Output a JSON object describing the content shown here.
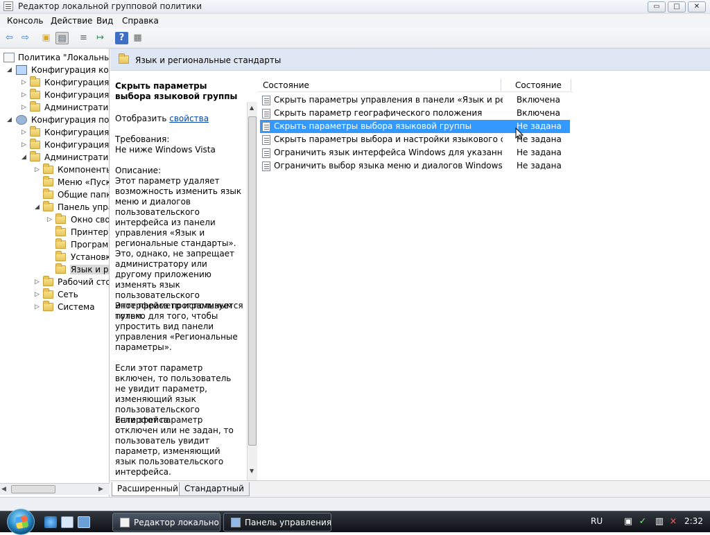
{
  "window": {
    "title": "Редактор локальной групповой политики",
    "controls": {
      "minimize": "▭",
      "maximize": "□",
      "close": "✕"
    }
  },
  "menu": {
    "items": [
      "Консоль",
      "Действие",
      "Вид",
      "Справка"
    ]
  },
  "toolbar": {
    "icons": [
      {
        "name": "back-arrow-icon",
        "glyph": "⇦",
        "color": "#2b78d0"
      },
      {
        "name": "forward-arrow-icon",
        "glyph": "⇨",
        "color": "#2b78d0"
      },
      {
        "name": "up-folder-icon",
        "glyph": "▣",
        "color": "#d9a92d"
      },
      {
        "name": "show-hide-tree-icon",
        "glyph": "▤",
        "color": "#5f6670"
      },
      {
        "name": "export-list-icon",
        "glyph": "≡",
        "color": "#666"
      },
      {
        "name": "export-arrow-icon",
        "glyph": "↦",
        "color": "#2e8b57"
      },
      {
        "name": "help-icon",
        "glyph": "?",
        "color": "#ffffff"
      },
      {
        "name": "extended-view-icon",
        "glyph": "▦",
        "color": "#666"
      }
    ]
  },
  "tree": {
    "items": [
      {
        "label": "Политика \"Локальный",
        "depth": 0,
        "expanded": "",
        "icon": "computer"
      },
      {
        "label": "Конфигурация комп",
        "depth": 1,
        "expanded": "◢",
        "icon": "computer"
      },
      {
        "label": "Конфигурация п",
        "depth": 2,
        "expanded": "▷",
        "icon": "folder"
      },
      {
        "label": "Конфигурация W",
        "depth": 2,
        "expanded": "▷",
        "icon": "folder"
      },
      {
        "label": "Административ",
        "depth": 2,
        "expanded": "▷",
        "icon": "folder"
      },
      {
        "label": "Конфигурация поль",
        "depth": 1,
        "expanded": "◢",
        "icon": "user"
      },
      {
        "label": "Конфигурация п",
        "depth": 2,
        "expanded": "▷",
        "icon": "folder"
      },
      {
        "label": "Конфигурация W",
        "depth": 2,
        "expanded": "▷",
        "icon": "folder"
      },
      {
        "label": "Административ",
        "depth": 2,
        "expanded": "◢",
        "icon": "folder"
      },
      {
        "label": "Компоненты",
        "depth": 3,
        "expanded": "▷",
        "icon": "folder"
      },
      {
        "label": "Меню «Пуск",
        "depth": 3,
        "expanded": "",
        "icon": "folder"
      },
      {
        "label": "Общие папк",
        "depth": 3,
        "expanded": "",
        "icon": "folder"
      },
      {
        "label": "Панель упра",
        "depth": 3,
        "expanded": "◢",
        "icon": "folder"
      },
      {
        "label": "Окно сво",
        "depth": 4,
        "expanded": "▷",
        "icon": "folder"
      },
      {
        "label": "Принтер",
        "depth": 4,
        "expanded": "",
        "icon": "folder"
      },
      {
        "label": "Програм",
        "depth": 4,
        "expanded": "",
        "icon": "folder"
      },
      {
        "label": "Установк",
        "depth": 4,
        "expanded": "",
        "icon": "folder"
      },
      {
        "label": "Язык и ре",
        "depth": 4,
        "expanded": "",
        "icon": "folder",
        "selected": true
      },
      {
        "label": "Рабочий сто",
        "depth": 3,
        "expanded": "▷",
        "icon": "folder"
      },
      {
        "label": "Сеть",
        "depth": 3,
        "expanded": "▷",
        "icon": "folder"
      },
      {
        "label": "Система",
        "depth": 3,
        "expanded": "▷",
        "icon": "folder"
      }
    ]
  },
  "main": {
    "header_title": "Язык и региональные стандарты",
    "description": {
      "title": "Скрыть параметры выбора языковой группы",
      "show_prefix": "Отобразить",
      "show_link": "свойства",
      "requirements_label": "Требования:",
      "requirements_value": "Не ниже Windows Vista",
      "description_label": "Описание:",
      "paragraphs": [
        "Этот параметр удаляет возможность изменить язык меню и диалогов пользовательского интерфейса из панели управления «Язык и региональные стандарты». Это, однако, не запрещает администратору или другому приложению изменять язык пользовательского интерфейса программным путем.",
        "Этот параметр используется только для того, чтобы упростить вид панели управления «Региональные параметры».",
        "Если этот параметр включен, то пользователь не увидит параметр, изменяющий язык пользовательского интерфейса.",
        "Если этот параметр отключен или не задан, то пользователь увидит параметр, изменяющий язык пользовательского интерфейса."
      ]
    },
    "list": {
      "columns": [
        "Состояние",
        "Состояние"
      ],
      "rows": [
        {
          "name": "Скрыть параметры управления в панели «Язык и регион...",
          "state": "Включена"
        },
        {
          "name": "Скрыть параметр географического положения",
          "state": "Включена"
        },
        {
          "name": "Скрыть параметры выбора языковой группы",
          "state": "Не задана",
          "selected": true
        },
        {
          "name": "Скрыть параметры выбора и настройки языкового станд...",
          "state": "Не задана"
        },
        {
          "name": "Ограничить язык интерфейса Windows для указанного п...",
          "state": "Не задана"
        },
        {
          "name": "Ограничить выбор языка меню и диалогов Windows",
          "state": "Не задана"
        }
      ]
    },
    "tabs": [
      "Расширенный",
      "Стандартный"
    ]
  },
  "taskbar": {
    "buttons": [
      "Редактор локально...",
      "Панель управления"
    ],
    "language": "RU",
    "time": "2:32"
  }
}
